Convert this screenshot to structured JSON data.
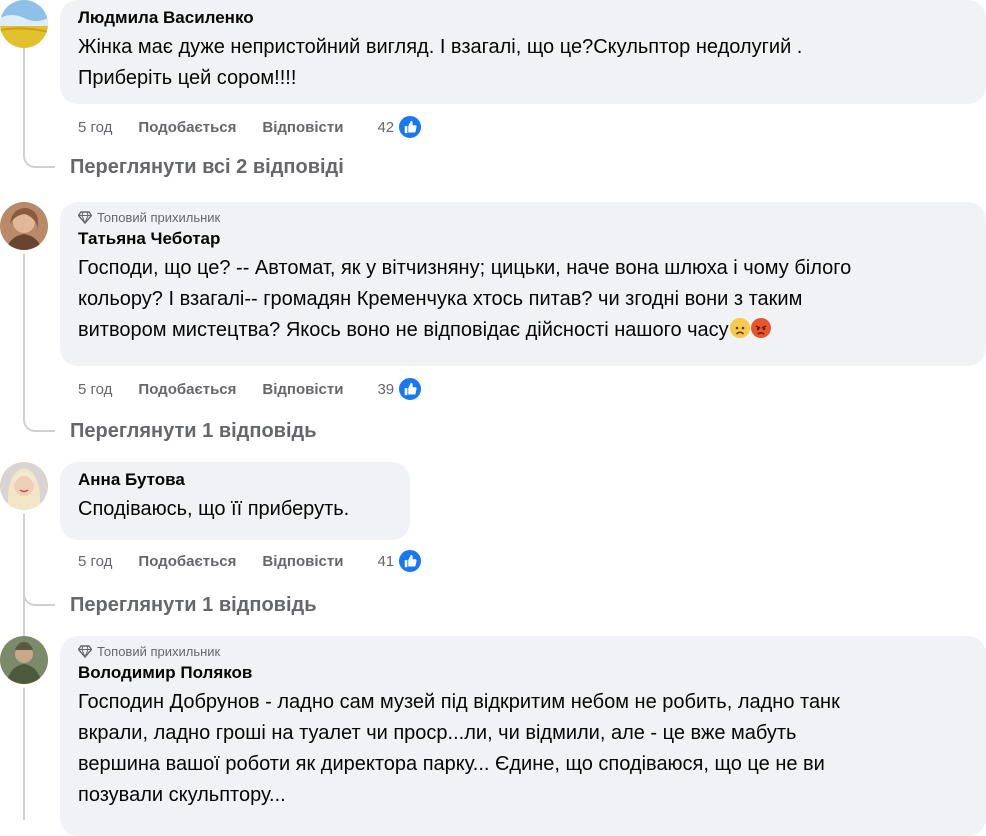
{
  "comments": [
    {
      "author": "Людмила Василенко",
      "badge": "",
      "text": "Жінка має дуже непристойний вигляд. І взагалі, що це?Скульптор недолугий .\nПриберіть цей сором!!!!",
      "time": "5 год",
      "like_label": "Подобається",
      "reply_label": "Відповісти",
      "likes": "42",
      "replies_link": "Переглянути всі 2 відповіді",
      "avatar_icon": "flag-avatar"
    },
    {
      "author": "Татьяна Чеботар",
      "badge": "Топовий прихильник",
      "text": "Господи, що це? -- Автомат, як у вітчизняну; цицьки, наче вона шлюха і чому білого\nкольору? І взагалі-- громадян Кременчука хтось питав? чи згодні вони з таким\nвитвором мистецтва? Якось воно не відповідає дійсності нашого часу",
      "time": "5 год",
      "like_label": "Подобається",
      "reply_label": "Відповісти",
      "likes": "39",
      "replies_link": "Переглянути 1 відповідь",
      "emojis": [
        "sad-face-icon",
        "angry-face-icon"
      ]
    },
    {
      "author": "Анна Бутова",
      "badge": "",
      "text": "Сподіваюсь, що її приберуть.",
      "time": "5 год",
      "like_label": "Подобається",
      "reply_label": "Відповісти",
      "likes": "41",
      "replies_link": "Переглянути 1 відповідь"
    },
    {
      "author": "Володимир Поляков",
      "badge": "Топовий прихильник",
      "text": "Господин Добрунов - ладно сам музей під відкритим небом не робить, ладно танк\nвкрали, ладно гроші на туалет чи проср...ли, чи відмили, але - це вже мабуть\nвершина вашої роботи як директора парку... Єдине, що сподіваюся, що це не ви\nпозували скульптору..."
    }
  ],
  "colors": {
    "bubble": "#f0f2f5",
    "secondary_text": "#65676b",
    "like_blue": "#1877f2",
    "thread_line": "#ced0d4"
  }
}
